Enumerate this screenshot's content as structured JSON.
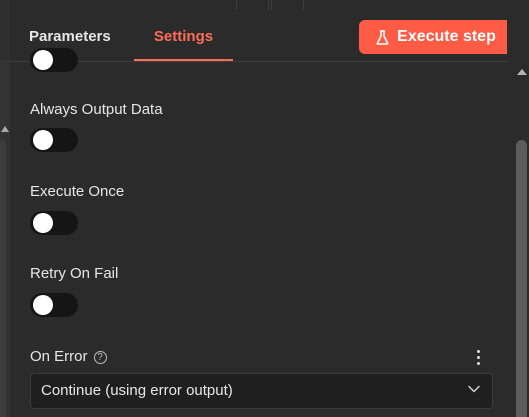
{
  "tabs": {
    "parameters": "Parameters",
    "settings": "Settings"
  },
  "execute_button": {
    "label": "Execute step",
    "icon": "flask-icon",
    "color": "#ff5b45"
  },
  "settings": {
    "always_output_data": {
      "label": "Always Output Data",
      "enabled": false
    },
    "execute_once": {
      "label": "Execute Once",
      "enabled": false
    },
    "retry_on_fail": {
      "label": "Retry On Fail",
      "enabled": false
    },
    "on_error": {
      "label": "On Error",
      "help_icon": "?",
      "selected": "Continue (using error output)"
    }
  },
  "colors": {
    "accent": "#ff6d5a",
    "background": "#2b2b2b"
  }
}
